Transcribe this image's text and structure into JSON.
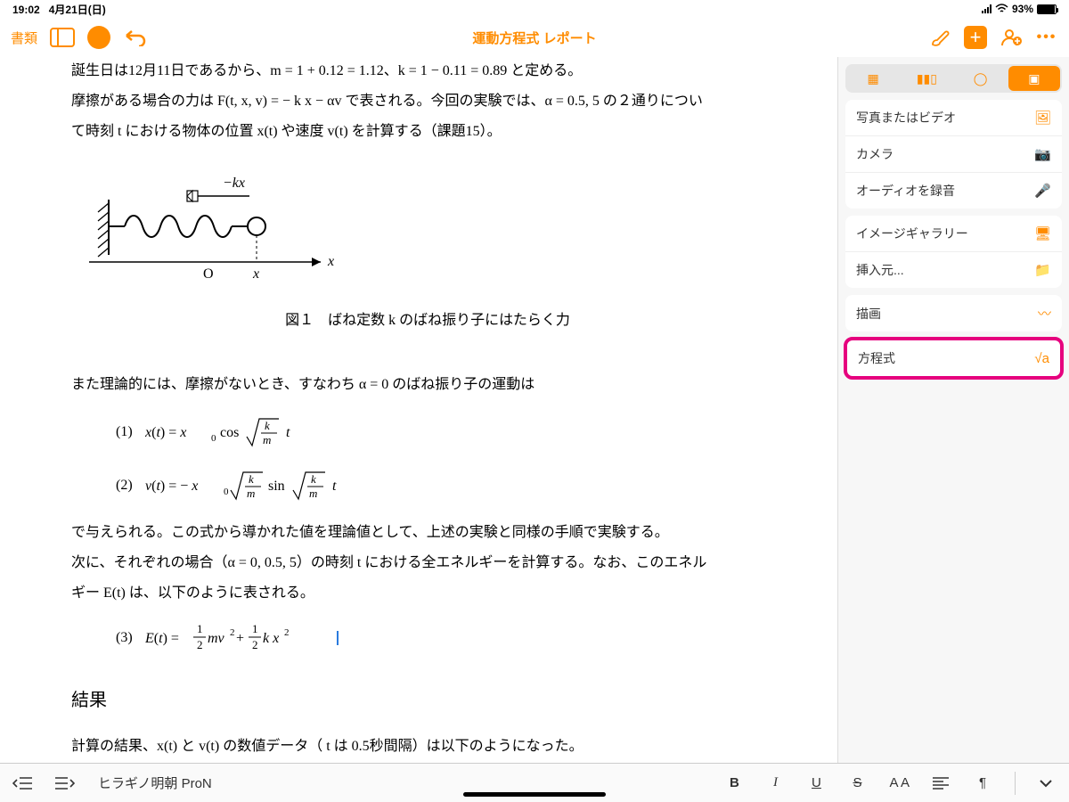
{
  "status": {
    "time": "19:02",
    "date": "4月21日(日)",
    "battery_pct": "93%"
  },
  "toolbar": {
    "docs_label": "書類",
    "title": "運動方程式 レポート"
  },
  "doc": {
    "line0_tail": "誕生日は12月11日であるから、m = 1 + 0.12 = 1.12、k = 1 − 0.11 = 0.89 と定める。",
    "line1": "摩擦がある場合の力は F(t, x, v) = − k x − αv で表される。今回の実験では、α = 0.5, 5 の２通りについ",
    "line2": "て時刻 t における物体の位置 x(t) や速度 v(t) を計算する（課題15）。",
    "fig_force_label": "−kx",
    "fig_axis_O": "O",
    "fig_axis_x": "x",
    "fig_axis_far": "x",
    "figcaption": "図１　ばね定数 k のばね振り子にはたらく力",
    "para2": "また理論的には、摩擦がないとき、すなわち α = 0 のばね振り子の運動は",
    "eq1_num": "(1)",
    "eq2_num": "(2)",
    "para3a": "で与えられる。この式から導かれた値を理論値として、上述の実験と同様の手順で実験する。",
    "para3b": "次に、それぞれの場合（α = 0, 0.5, 5）の時刻  t   における全エネルギーを計算する。なお、このエネル",
    "para3c": "ギー E(t) は、以下のように表される。",
    "eq3_num": "(3)",
    "heading_result": "結果",
    "result_line": "計算の結果、x(t) と v(t) の数値データ（ t は 0.5秒間隔）は以下のようになった。"
  },
  "insert_menu": {
    "photo_video": "写真またはビデオ",
    "camera": "カメラ",
    "record_audio": "オーディオを録音",
    "image_gallery": "イメージギャラリー",
    "insert_from": "挿入元...",
    "drawing": "描画",
    "equation": "方程式"
  },
  "formatbar": {
    "font_name": "ヒラギノ明朝 ProN",
    "bold": "B",
    "italic": "I",
    "underline": "U",
    "caps": "A A",
    "pilcrow": "¶"
  }
}
